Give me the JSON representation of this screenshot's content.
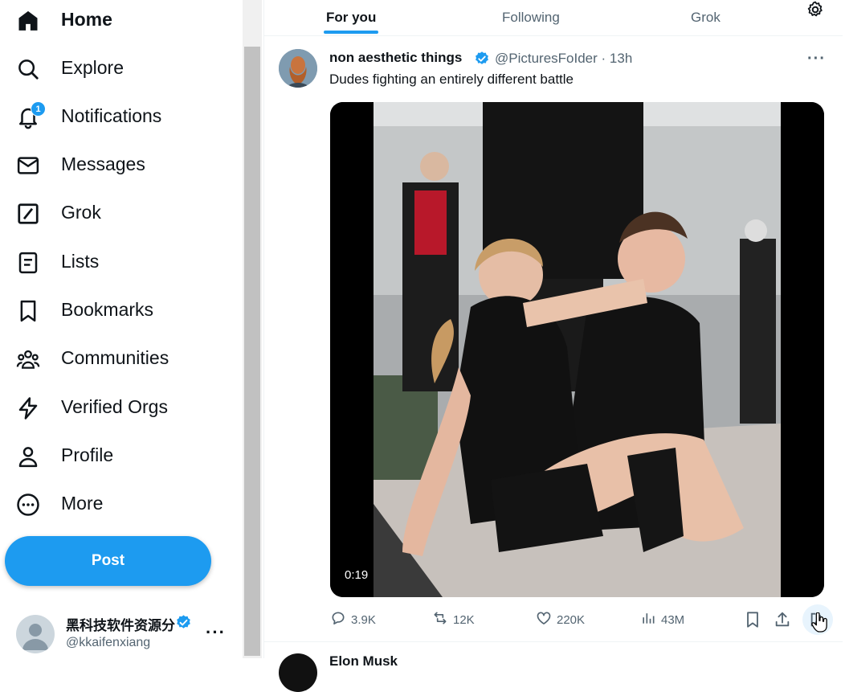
{
  "nav": {
    "items": [
      {
        "label": "Home",
        "icon": "home-icon",
        "active": true
      },
      {
        "label": "Explore",
        "icon": "search-icon"
      },
      {
        "label": "Notifications",
        "icon": "bell-icon",
        "badge": "1"
      },
      {
        "label": "Messages",
        "icon": "mail-icon"
      },
      {
        "label": "Grok",
        "icon": "grok-icon"
      },
      {
        "label": "Lists",
        "icon": "list-icon"
      },
      {
        "label": "Bookmarks",
        "icon": "bookmark-icon"
      },
      {
        "label": "Communities",
        "icon": "communities-icon"
      },
      {
        "label": "Verified Orgs",
        "icon": "lightning-icon"
      },
      {
        "label": "Profile",
        "icon": "person-icon"
      },
      {
        "label": "More",
        "icon": "more-circle-icon"
      }
    ],
    "post_label": "Post"
  },
  "account": {
    "name": "黑科技软件资源分",
    "handle": "@kkaifenxiang",
    "more": "···"
  },
  "tabs": [
    {
      "label": "For you",
      "active": true
    },
    {
      "label": "Following"
    },
    {
      "label": "Grok"
    }
  ],
  "tweet": {
    "author": "non aesthetic things",
    "handle_time": "@PicturesFoIder · 13h",
    "text": "Dudes fighting an entirely different battle",
    "more": "···",
    "video_duration": "0:19",
    "stats": {
      "replies": "3.9K",
      "reposts": "12K",
      "likes": "220K",
      "views": "43M"
    }
  },
  "next_tweet": {
    "author": "Elon Musk"
  },
  "colors": {
    "accent": "#1d9bf0",
    "text": "#0f1419",
    "muted": "#536471"
  }
}
